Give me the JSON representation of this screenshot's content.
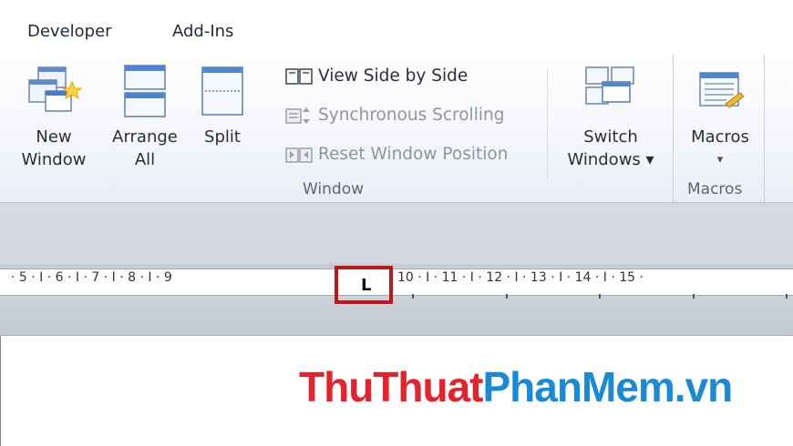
{
  "tabs": [
    {
      "label": "Developer"
    },
    {
      "label": "Add-Ins"
    }
  ],
  "ribbon": {
    "new_window": {
      "line1": "New",
      "line2": "Window"
    },
    "arrange_all": {
      "line1": "Arrange",
      "line2": "All"
    },
    "split": {
      "label": "Split"
    },
    "view_side_by_side": "View Side by Side",
    "synchronous_scrolling": "Synchronous Scrolling",
    "reset_window_position": "Reset Window Position",
    "switch_windows": {
      "line1": "Switch",
      "line2": "Windows ▾"
    },
    "macros": {
      "label": "Macros",
      "arrow": "▾"
    },
    "groups": {
      "window": "Window",
      "macros": "Macros"
    }
  },
  "ruler": {
    "text_left": "· 5 · I · 6 · I · 7 · I · 8 · I · 9",
    "text_right": "10 · I · 11 · I · 12 · I · 13 · I · 14 · I · 15 ·",
    "tab_stop": "L"
  },
  "brand": {
    "part1": "ThuThuat",
    "part2": "PhanMem.vn"
  },
  "colors": {
    "brand_red": "#e5232d",
    "brand_blue": "#1a8ad4",
    "highlight": "#c0151b"
  }
}
